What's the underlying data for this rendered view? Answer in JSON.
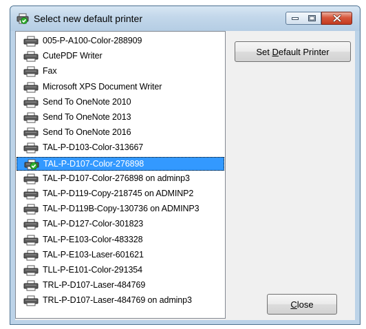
{
  "window": {
    "title": "Select new default printer",
    "title_icon": "printer-check-icon",
    "minimize_icon": "minimize-icon",
    "maximize_icon": "maximize-icon",
    "close_icon": "close-x-icon"
  },
  "printers": [
    {
      "label": "005-P-A100-Color-288909",
      "icon": "printer-icon"
    },
    {
      "label": "CutePDF Writer",
      "icon": "printer-icon"
    },
    {
      "label": "Fax",
      "icon": "printer-icon"
    },
    {
      "label": "Microsoft XPS Document Writer",
      "icon": "printer-icon"
    },
    {
      "label": "Send To OneNote 2010",
      "icon": "printer-icon"
    },
    {
      "label": "Send To OneNote 2013",
      "icon": "printer-icon"
    },
    {
      "label": "Send To OneNote 2016",
      "icon": "printer-icon"
    },
    {
      "label": "TAL-P-D103-Color-313667",
      "icon": "printer-icon"
    },
    {
      "label": "TAL-P-D107-Color-276898",
      "icon": "default-printer-check-icon",
      "selected": true
    },
    {
      "label": "TAL-P-D107-Color-276898 on adminp3",
      "icon": "printer-icon"
    },
    {
      "label": "TAL-P-D119-Copy-218745 on ADMINP2",
      "icon": "printer-icon"
    },
    {
      "label": "TAL-P-D119B-Copy-130736 on ADMINP3",
      "icon": "printer-icon"
    },
    {
      "label": "TAL-P-D127-Color-301823",
      "icon": "printer-icon"
    },
    {
      "label": "TAL-P-E103-Color-483328",
      "icon": "printer-icon"
    },
    {
      "label": "TAL-P-E103-Laser-601621",
      "icon": "printer-icon"
    },
    {
      "label": "TLL-P-E101-Color-291354",
      "icon": "printer-icon"
    },
    {
      "label": "TRL-P-D107-Laser-484769",
      "icon": "printer-icon"
    },
    {
      "label": "TRL-P-D107-Laser-484769 on adminp3",
      "icon": "printer-icon"
    }
  ],
  "buttons": {
    "set_default": {
      "before": "Set ",
      "mnemonic": "D",
      "after": "efault Printer"
    },
    "close": {
      "before": "",
      "mnemonic": "C",
      "after": "lose"
    }
  },
  "colors": {
    "selection": "#3399ff",
    "check_green": "#2fb12f",
    "close_red": "#c9432b"
  }
}
